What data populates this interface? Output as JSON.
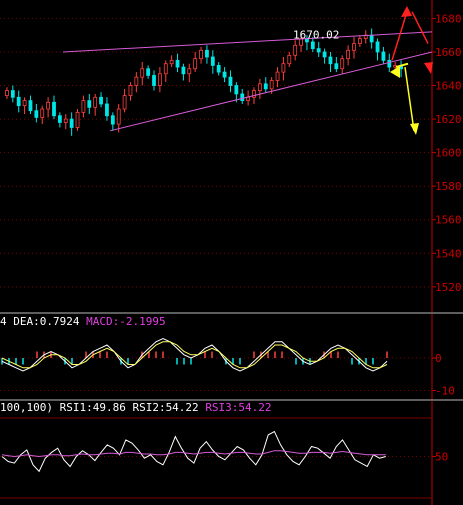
{
  "colors": {
    "background": "#000000",
    "axis": "#c00000",
    "grid": "#7a0000",
    "tick_label": "#cc0000",
    "candle_up": "#ff4040",
    "candle_down": "#00e5e5",
    "channel_line": "#d65cd6",
    "arrow_up": "#ff2020",
    "arrow_down": "#ffff20",
    "macd_dif": "#ffffff",
    "macd_dea": "#ffff60",
    "rsi_fast": "#ffffff",
    "rsi_slow": "#d65cd6",
    "label_white": "#ffffff",
    "label_magenta": "#e040e0"
  },
  "chart_data": [
    {
      "type": "candlestick",
      "panel": "price",
      "ylim": [
        1505,
        1688
      ],
      "y_ticks": [
        1520,
        1540,
        1560,
        1580,
        1600,
        1620,
        1640,
        1660,
        1680
      ],
      "grid": true,
      "annotation": "1670.02",
      "close_series": [
        1637,
        1633,
        1628,
        1631,
        1625,
        1621,
        1626,
        1630,
        1622,
        1618,
        1620,
        1615,
        1624,
        1631,
        1627,
        1633,
        1629,
        1622,
        1617,
        1626,
        1634,
        1640,
        1645,
        1650,
        1646,
        1640,
        1647,
        1653,
        1655,
        1651,
        1647,
        1650,
        1656,
        1661,
        1657,
        1652,
        1648,
        1645,
        1640,
        1635,
        1631,
        1633,
        1637,
        1641,
        1638,
        1643,
        1648,
        1653,
        1658,
        1664,
        1668,
        1666,
        1662,
        1660,
        1657,
        1653,
        1650,
        1656,
        1661,
        1665,
        1668,
        1670,
        1666,
        1660,
        1655,
        1651,
        1652,
        1650
      ]
    },
    {
      "type": "line",
      "panel": "macd",
      "title": "DEA:0.7924  MACD:-2.1995",
      "y_ticks": [
        0,
        -10
      ],
      "ylim": [
        -12,
        8
      ],
      "series": [
        {
          "name": "DIF",
          "values": [
            -1,
            -2,
            -3,
            -4,
            -3,
            -1,
            1,
            2,
            1,
            -1,
            -3,
            -2,
            0,
            2,
            3,
            4,
            2,
            -1,
            -3,
            -2,
            1,
            3,
            5,
            6,
            5,
            3,
            1,
            0,
            1,
            3,
            4,
            2,
            -1,
            -3,
            -4,
            -3,
            -1,
            1,
            3,
            5,
            5,
            3,
            1,
            -1,
            -2,
            -1,
            1,
            3,
            4,
            3,
            1,
            -1,
            -3,
            -4,
            -3,
            -1
          ]
        },
        {
          "name": "DEA",
          "values": [
            0,
            -1,
            -2,
            -3,
            -3,
            -2,
            0,
            1,
            1,
            0,
            -2,
            -2,
            -1,
            1,
            2,
            3,
            2,
            0,
            -2,
            -2,
            0,
            2,
            4,
            5,
            5,
            4,
            2,
            1,
            1,
            2,
            3,
            2,
            0,
            -2,
            -3,
            -3,
            -2,
            0,
            2,
            4,
            4,
            3,
            2,
            0,
            -1,
            -1,
            0,
            2,
            3,
            3,
            2,
            0,
            -2,
            -3,
            -3,
            -2
          ]
        },
        {
          "name": "MACD",
          "values": [
            -2,
            -2,
            -2,
            -2,
            0,
            2,
            2,
            2,
            0,
            -2,
            -2,
            0,
            2,
            2,
            2,
            2,
            0,
            -2,
            -2,
            0,
            2,
            2,
            2,
            2,
            0,
            -2,
            -2,
            -2,
            0,
            2,
            2,
            0,
            -2,
            -2,
            -2,
            0,
            2,
            2,
            2,
            2,
            2,
            0,
            -2,
            -2,
            -2,
            0,
            2,
            2,
            2,
            0,
            -2,
            -2,
            -2,
            -2,
            0,
            2
          ]
        }
      ]
    },
    {
      "type": "line",
      "panel": "rsi",
      "title": "100,100)  RSI1:49.86  RSI2:54.22  RSI3:54.22",
      "y_ticks": [
        50
      ],
      "ylim": [
        0,
        100
      ],
      "series": [
        {
          "name": "RSI1",
          "values": [
            50,
            44,
            42,
            52,
            58,
            40,
            32,
            48,
            55,
            60,
            46,
            38,
            50,
            57,
            52,
            45,
            55,
            64,
            60,
            52,
            70,
            66,
            58,
            48,
            52,
            44,
            40,
            55,
            74,
            60,
            48,
            42,
            60,
            68,
            58,
            50,
            46,
            54,
            62,
            58,
            48,
            40,
            52,
            76,
            80,
            64,
            52,
            44,
            40,
            50,
            62,
            60,
            54,
            48,
            62,
            70,
            58,
            46,
            42,
            38,
            52,
            48,
            50
          ]
        },
        {
          "name": "RSI2",
          "values": [
            52,
            51,
            50,
            51,
            52,
            51,
            50,
            51,
            52,
            52,
            51,
            51,
            52,
            53,
            52,
            52,
            53,
            54,
            54,
            53,
            55,
            55,
            54,
            53,
            53,
            52,
            52,
            53,
            55,
            55,
            54,
            53,
            54,
            55,
            55,
            54,
            53,
            54,
            55,
            55,
            54,
            53,
            53,
            55,
            57,
            57,
            56,
            55,
            54,
            54,
            55,
            55,
            55,
            54,
            55,
            56,
            55,
            54,
            53,
            52,
            52,
            52,
            52
          ]
        }
      ]
    }
  ],
  "labels": {
    "dea_prefix": "4 DEA:0.7924",
    "macd": "MACD:-2.1995",
    "rsi_prefix": "100,100) RSI1:49.86 RSI2:54.22",
    "rsi3": "RSI3:54.22"
  }
}
